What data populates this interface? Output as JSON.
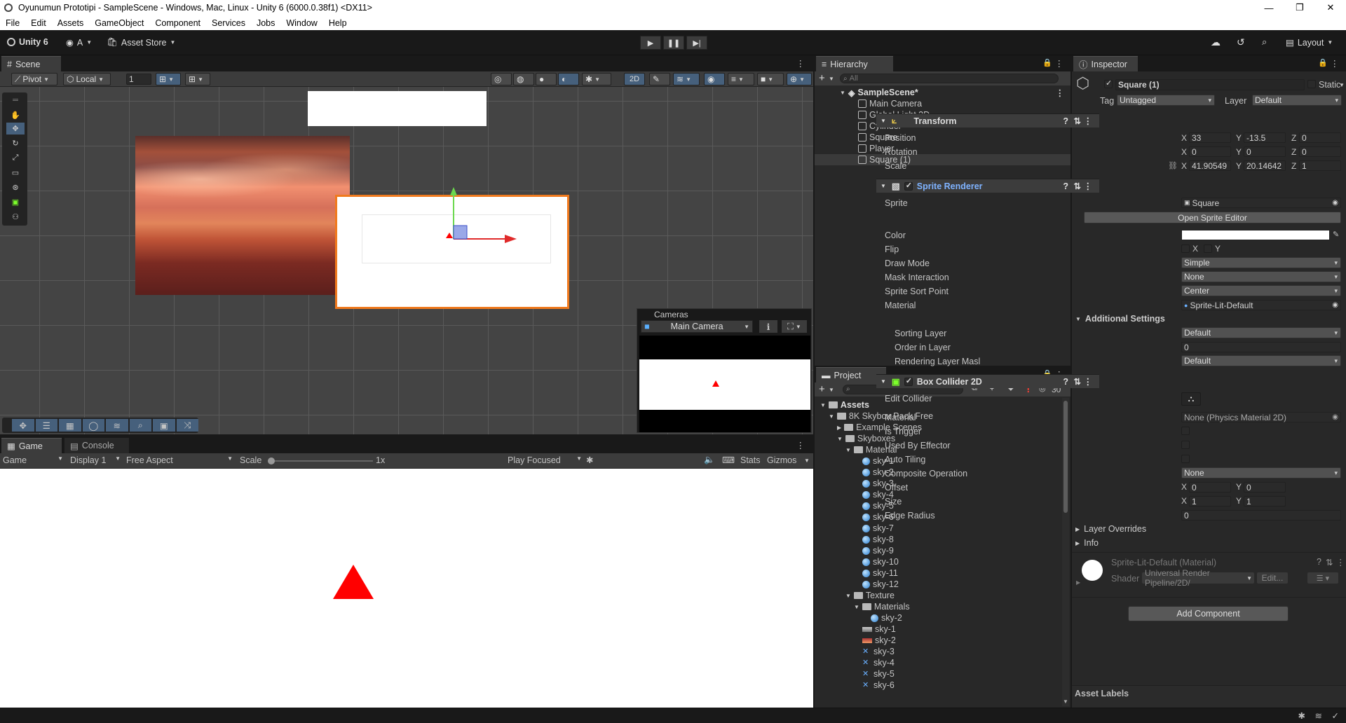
{
  "window": {
    "title": "Oyunumun Prototipi - SampleScene - Windows, Mac, Linux - Unity 6 (6000.0.38f1) <DX11>"
  },
  "menu": [
    "File",
    "Edit",
    "Assets",
    "GameObject",
    "Component",
    "Services",
    "Jobs",
    "Window",
    "Help"
  ],
  "toolbar": {
    "unity_label": "Unity 6",
    "account_label": "A",
    "asset_store": "Asset Store",
    "layout": "Layout"
  },
  "scene": {
    "tab": "Scene",
    "pivot": "Pivot",
    "local": "Local",
    "grid_value": "1",
    "mode_2d": "2D"
  },
  "cameras_overlay": {
    "title": "Cameras",
    "camera": "Main Camera"
  },
  "game": {
    "tab": "Game",
    "console_tab": "Console",
    "mode": "Game",
    "display": "Display 1",
    "aspect": "Free Aspect",
    "scale_label": "Scale",
    "scale_value": "1x",
    "play_focused": "Play Focused",
    "stats": "Stats",
    "gizmos": "Gizmos"
  },
  "hierarchy": {
    "tab": "Hierarchy",
    "search_placeholder": "All",
    "scene": "SampleScene*",
    "items": [
      "Main Camera",
      "Global Light 2D",
      "Cylinder",
      "Square",
      "Player",
      "Square (1)"
    ]
  },
  "project": {
    "tab": "Project",
    "count": "30",
    "tree": [
      {
        "label": "Assets",
        "depth": 0,
        "icon": "folder",
        "bold": true
      },
      {
        "label": "8K Skybox Pack Free",
        "depth": 1,
        "icon": "folder"
      },
      {
        "label": "Example Scenes",
        "depth": 2,
        "icon": "folder"
      },
      {
        "label": "Skyboxes",
        "depth": 2,
        "icon": "folder"
      },
      {
        "label": "Material",
        "depth": 3,
        "icon": "folder"
      },
      {
        "label": "sky-1",
        "depth": 4,
        "icon": "material"
      },
      {
        "label": "sky-2",
        "depth": 4,
        "icon": "material"
      },
      {
        "label": "sky-3",
        "depth": 4,
        "icon": "material"
      },
      {
        "label": "sky-4",
        "depth": 4,
        "icon": "material"
      },
      {
        "label": "sky-5",
        "depth": 4,
        "icon": "material"
      },
      {
        "label": "sky-6",
        "depth": 4,
        "icon": "material"
      },
      {
        "label": "sky-7",
        "depth": 4,
        "icon": "material"
      },
      {
        "label": "sky-8",
        "depth": 4,
        "icon": "material"
      },
      {
        "label": "sky-9",
        "depth": 4,
        "icon": "material"
      },
      {
        "label": "sky-10",
        "depth": 4,
        "icon": "material"
      },
      {
        "label": "sky-11",
        "depth": 4,
        "icon": "material"
      },
      {
        "label": "sky-12",
        "depth": 4,
        "icon": "material"
      },
      {
        "label": "Texture",
        "depth": 3,
        "icon": "folder"
      },
      {
        "label": "Materials",
        "depth": 4,
        "icon": "folder"
      },
      {
        "label": "sky-2",
        "depth": 5,
        "icon": "material"
      },
      {
        "label": "sky-1",
        "depth": 4,
        "icon": "texture"
      },
      {
        "label": "sky-2",
        "depth": 4,
        "icon": "texture-red"
      },
      {
        "label": "sky-3",
        "depth": 4,
        "icon": "texture-x"
      },
      {
        "label": "sky-4",
        "depth": 4,
        "icon": "texture-x"
      },
      {
        "label": "sky-5",
        "depth": 4,
        "icon": "texture-x"
      },
      {
        "label": "sky-6",
        "depth": 4,
        "icon": "texture-x"
      }
    ]
  },
  "inspector": {
    "tab": "Inspector",
    "object_name": "Square (1)",
    "static_label": "Static",
    "tag_label": "Tag",
    "tag": "Untagged",
    "layer_label": "Layer",
    "layer": "Default",
    "transform": {
      "title": "Transform",
      "position_label": "Position",
      "position": [
        "33",
        "-13.5",
        "0"
      ],
      "rotation_label": "Rotation",
      "rotation": [
        "0",
        "0",
        "0"
      ],
      "scale_label": "Scale",
      "scale": [
        "41.90549",
        "20.14642",
        "1"
      ]
    },
    "sprite_renderer": {
      "title": "Sprite Renderer",
      "sprite_label": "Sprite",
      "sprite": "Square",
      "open_editor": "Open Sprite Editor",
      "color_label": "Color",
      "flip_label": "Flip",
      "flip_x": "X",
      "flip_y": "Y",
      "draw_mode_label": "Draw Mode",
      "draw_mode": "Simple",
      "mask_label": "Mask Interaction",
      "mask": "None",
      "sort_point_label": "Sprite Sort Point",
      "sort_point": "Center",
      "material_label": "Material",
      "material": "Sprite-Lit-Default",
      "additional": "Additional Settings",
      "sorting_layer_label": "Sorting Layer",
      "sorting_layer": "Default",
      "order_label": "Order in Layer",
      "order": "0",
      "rendering_label": "Rendering Layer Masl",
      "rendering": "Default"
    },
    "box_collider": {
      "title": "Box Collider 2D",
      "edit_label": "Edit Collider",
      "material_label": "Material",
      "material": "None (Physics Material 2D)",
      "trigger_label": "Is Trigger",
      "effector_label": "Used By Effector",
      "tiling_label": "Auto Tiling",
      "composite_label": "Composite Operation",
      "composite": "None",
      "offset_label": "Offset",
      "offset": [
        "0",
        "0"
      ],
      "size_label": "Size",
      "size": [
        "1",
        "1"
      ],
      "edge_label": "Edge Radius",
      "edge": "0",
      "overrides": "Layer Overrides",
      "info": "Info"
    },
    "material_preview": {
      "name": "Sprite-Lit-Default (Material)",
      "shader_label": "Shader",
      "shader": "Universal Render Pipeline/2D/",
      "edit": "Edit..."
    },
    "add_component": "Add Component",
    "asset_labels": "Asset Labels"
  },
  "axis": {
    "x": "X",
    "y": "Y",
    "z": "Z"
  },
  "colors": {
    "accent": "#46607c",
    "selection_orange": "#f07a1e",
    "triangle": "#ff0000"
  }
}
